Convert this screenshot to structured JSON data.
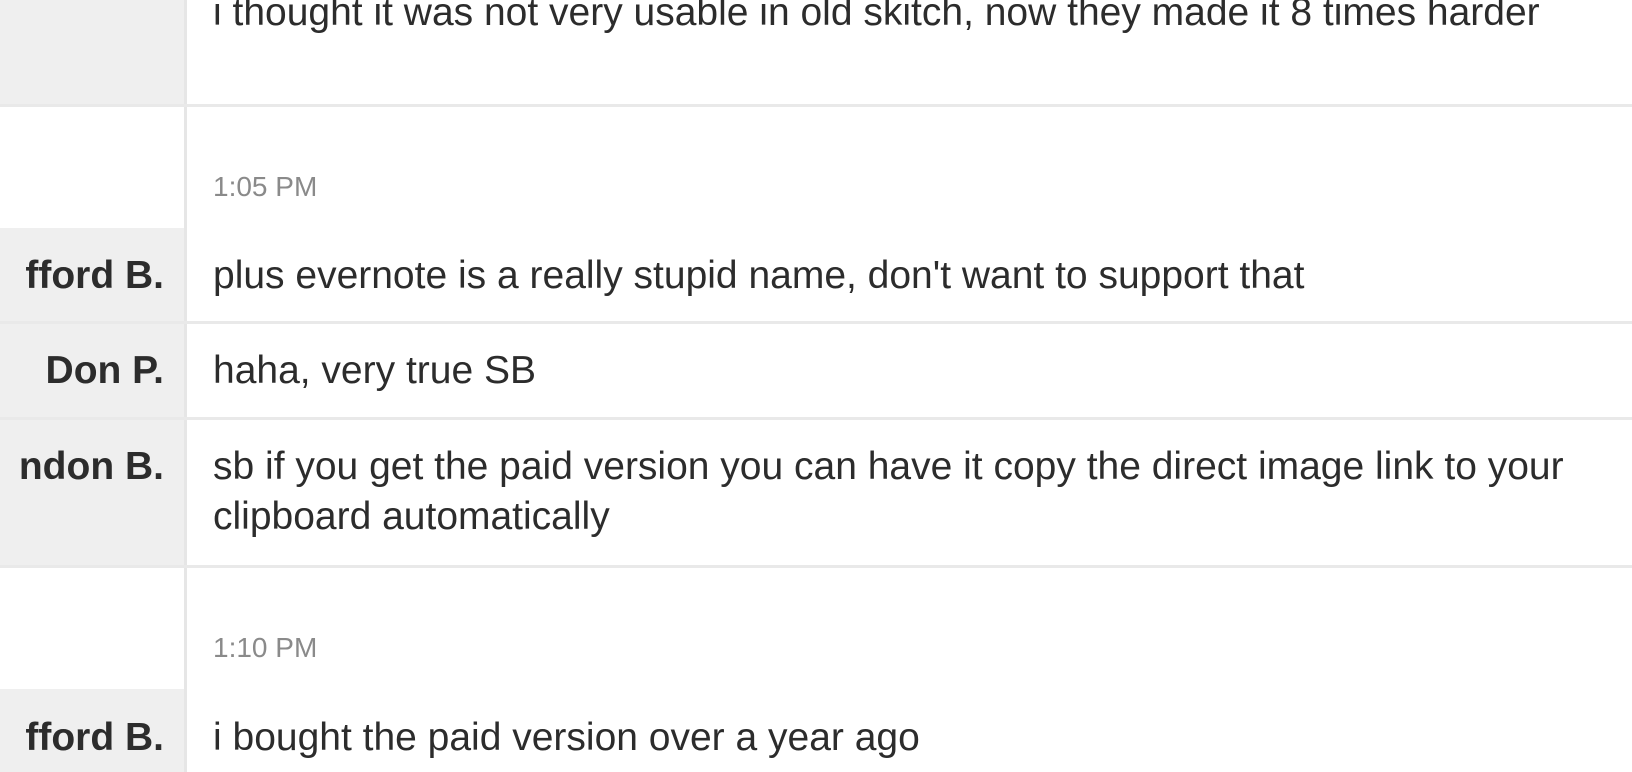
{
  "messages": [
    {
      "type": "message",
      "author": "",
      "text": "i thought it was not very usable in old skitch, now they made it 8 times harder"
    },
    {
      "type": "timestamp",
      "time": "1:05 PM"
    },
    {
      "type": "message",
      "author": "fford B.",
      "text": "plus evernote is a really stupid name, don't want to support that"
    },
    {
      "type": "message",
      "author": "Don P.",
      "text": "haha, very true SB"
    },
    {
      "type": "message",
      "author": "ndon B.",
      "text": "sb if you get the paid version you can have it copy the direct image link to your clipboard automatically"
    },
    {
      "type": "timestamp",
      "time": "1:10 PM"
    },
    {
      "type": "message",
      "author": "fford B.",
      "text": "i bought the paid version over a year ago"
    }
  ]
}
